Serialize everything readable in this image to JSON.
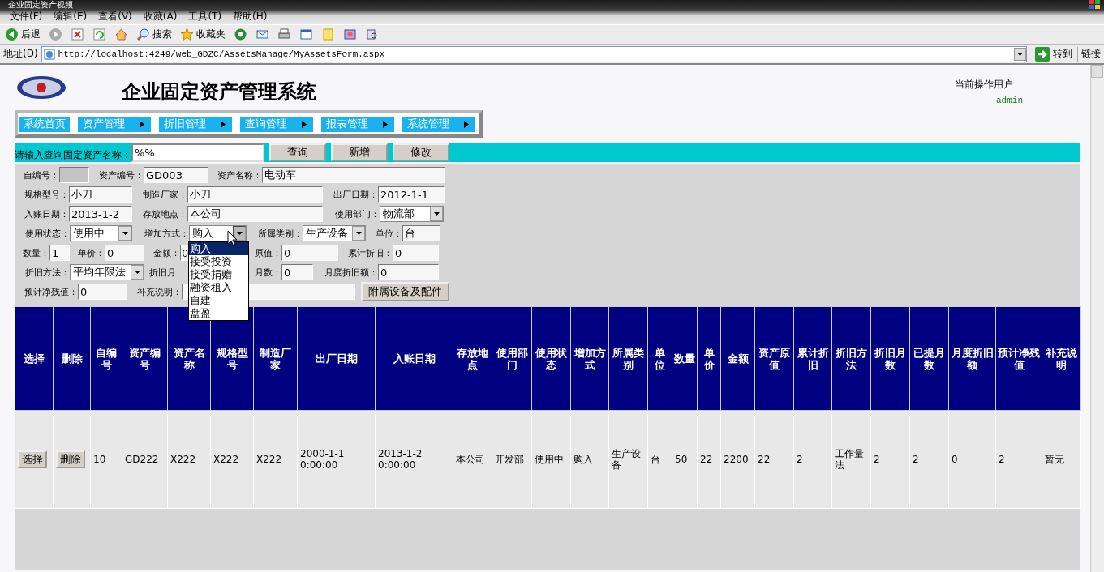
{
  "window": {
    "title": "企业固定资产视频"
  },
  "menu_bar": [
    "文件(F)",
    "编辑(E)",
    "查看(V)",
    "收藏(A)",
    "工具(T)",
    "帮助(H)"
  ],
  "toolbar": [
    {
      "kind": "back",
      "label": "后退"
    },
    {
      "kind": "forward"
    },
    {
      "kind": "stop"
    },
    {
      "kind": "refresh"
    },
    {
      "kind": "home"
    },
    {
      "kind": "search",
      "label": "搜索"
    },
    {
      "kind": "favorites",
      "label": "收藏夹"
    },
    {
      "kind": "media"
    },
    {
      "kind": "mail"
    },
    {
      "kind": "print"
    },
    {
      "kind": "edit"
    },
    {
      "kind": "note"
    },
    {
      "kind": "messenger"
    },
    {
      "kind": "research"
    }
  ],
  "address_bar": {
    "label": "地址(D)",
    "url": "http://localhost:4249/web_GDZC/AssetsManage/MyAssetsForm.aspx",
    "go": "转到",
    "links": "链接"
  },
  "header": {
    "title": "企业固定资产管理系统",
    "user_label": "当前操作用户",
    "user": "admin"
  },
  "nav": [
    {
      "label": "系统首页",
      "submenu": false
    },
    {
      "label": "资产管理",
      "submenu": true
    },
    {
      "label": "折旧管理",
      "submenu": true
    },
    {
      "label": "查询管理",
      "submenu": true
    },
    {
      "label": "报表管理",
      "submenu": true
    },
    {
      "label": "系统管理",
      "submenu": true
    }
  ],
  "search": {
    "label": "请输入查询固定资产名称：",
    "value": "%%",
    "buttons": [
      "查询",
      "新增",
      "修改"
    ]
  },
  "form": {
    "lines": [
      [
        {
          "kind": "text",
          "label": "自编号：",
          "disabled": true
        },
        {
          "kind": "text",
          "label": "资产编号：",
          "value": "GD003",
          "disabled": false
        },
        {
          "kind": "text",
          "label": "资产名称：",
          "value": "电动车",
          "disabled": false
        }
      ],
      [
        {
          "kind": "text",
          "label": "规格型号：",
          "value": "小刀",
          "disabled": false
        },
        {
          "kind": "text",
          "label": "制造厂家：",
          "value": "小刀",
          "disabled": false
        },
        {
          "kind": "text",
          "label": "出厂日期：",
          "value": "2012-1-1",
          "disabled": false
        }
      ],
      [
        {
          "kind": "text",
          "label": "入账日期：",
          "value": "2013-1-2",
          "disabled": false
        },
        {
          "kind": "text",
          "label": "存放地点：",
          "value": "本公司",
          "disabled": false
        },
        {
          "kind": "select",
          "label": "使用部门：",
          "value": "物流部",
          "expanded": false
        }
      ],
      [
        {
          "kind": "select",
          "label": "使用状态：",
          "value": "使用中",
          "expanded": false
        },
        {
          "kind": "select",
          "label": "增加方式：",
          "value": "购入",
          "expanded": true,
          "options": [
            {
              "label": "购入",
              "selected": true
            },
            {
              "label": "接受投资",
              "selected": false
            },
            {
              "label": "接受捐赠",
              "selected": false
            },
            {
              "label": "融资租入",
              "selected": false
            },
            {
              "label": "自建",
              "selected": false
            },
            {
              "label": "盘盈",
              "selected": false
            }
          ]
        },
        {
          "kind": "select",
          "label": "所属类别：",
          "value": "生产设备",
          "expanded": false
        },
        {
          "kind": "text",
          "label": "单位：",
          "value": "台",
          "disabled": false
        }
      ],
      [
        {
          "kind": "text",
          "label": "数量：",
          "value": "1",
          "disabled": false
        },
        {
          "kind": "text",
          "label": "单价：",
          "value": "0",
          "disabled": false
        },
        {
          "kind": "text",
          "label": "金额：",
          "value": "0",
          "disabled": false
        },
        {
          "kind": "text",
          "label": "原值：",
          "value": "0",
          "disabled": false
        },
        {
          "kind": "text",
          "label": "累计折旧：",
          "value": "0",
          "disabled": false
        }
      ],
      [
        {
          "kind": "select",
          "label": "折旧方法：",
          "value": "平均年限法",
          "expanded": false
        },
        {
          "kind": "label",
          "label": "折旧月"
        },
        {
          "kind": "text",
          "label": "月数：",
          "value": "0",
          "disabled": false
        },
        {
          "kind": "text",
          "label": "月度折旧额：",
          "value": "0",
          "disabled": false
        }
      ],
      [
        {
          "kind": "text",
          "label": "预计净残值：",
          "value": "0",
          "disabled": false
        },
        {
          "kind": "text",
          "label": "补充说明：",
          "disabled": false
        },
        {
          "kind": "button",
          "label": "附属设备及配件"
        }
      ]
    ]
  },
  "table": {
    "columns": [
      {
        "label": "选择",
        "kind": "button"
      },
      {
        "label": "删除",
        "kind": "button"
      },
      {
        "label": "自编号",
        "kind": "text"
      },
      {
        "label": "资产编号",
        "kind": "text"
      },
      {
        "label": "资产名称",
        "kind": "text"
      },
      {
        "label": "规格型号",
        "kind": "text"
      },
      {
        "label": "制造厂家",
        "kind": "text"
      },
      {
        "label": "出厂日期",
        "kind": "text"
      },
      {
        "label": "入账日期",
        "kind": "text"
      },
      {
        "label": "存放地点",
        "kind": "text"
      },
      {
        "label": "使用部门",
        "kind": "text"
      },
      {
        "label": "使用状态",
        "kind": "text"
      },
      {
        "label": "增加方式",
        "kind": "text"
      },
      {
        "label": "所属类别",
        "kind": "text"
      },
      {
        "label": "单位",
        "kind": "text"
      },
      {
        "label": "数量",
        "kind": "text"
      },
      {
        "label": "单价",
        "kind": "text"
      },
      {
        "label": "金额",
        "kind": "text"
      },
      {
        "label": "资产原值",
        "kind": "text"
      },
      {
        "label": "累计折旧",
        "kind": "text"
      },
      {
        "label": "折旧方法",
        "kind": "text"
      },
      {
        "label": "折旧月数",
        "kind": "text"
      },
      {
        "label": "已提月数",
        "kind": "text"
      },
      {
        "label": "月度折旧额",
        "kind": "text"
      },
      {
        "label": "预计净残值",
        "kind": "text"
      },
      {
        "label": "补充说明",
        "kind": "text"
      }
    ],
    "rows": [
      {
        "cells": [
          "选择",
          "删除",
          "10",
          "GD222",
          "X222",
          "X222",
          "X222",
          "2000-1-1 0:00:00",
          "2013-1-2 0:00:00",
          "本公司",
          "开发部",
          "使用中",
          "购入",
          "生产设备",
          "台",
          "50",
          "22",
          "2200",
          "22",
          "2",
          "工作量法",
          "2",
          "2",
          "0",
          "2",
          "暂无"
        ]
      }
    ]
  }
}
